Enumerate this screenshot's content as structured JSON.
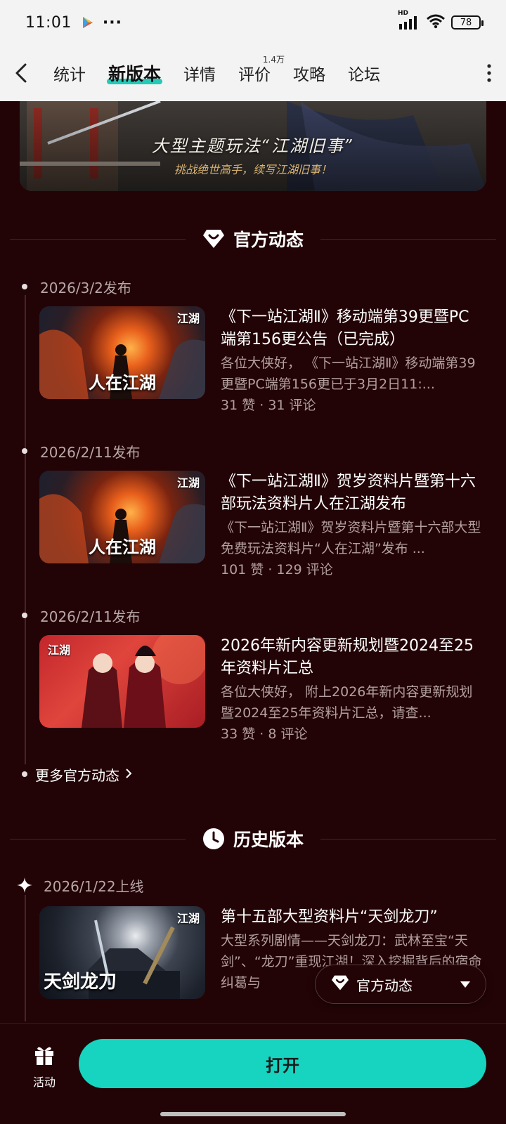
{
  "status_bar": {
    "time": "11:01",
    "dots": "···",
    "hd": "HD",
    "battery": "78"
  },
  "nav": {
    "tabs": [
      {
        "label": "统计"
      },
      {
        "label": "新版本"
      },
      {
        "label": "详情"
      },
      {
        "label": "评价",
        "badge": "1.4万"
      },
      {
        "label": "攻略"
      },
      {
        "label": "论坛"
      }
    ],
    "active_tab": "新版本",
    "accent": "#18c6b4"
  },
  "banner": {
    "title": "大型主题玩法“江湖旧事”",
    "subtitle": "挑战绝世高手，续写江湖旧事！"
  },
  "official": {
    "heading": "官方动态",
    "items": [
      {
        "date": "2026/3/2发布",
        "thumb_text": "人在江湖",
        "thumb_tag": "江湖",
        "title": "《下一站江湖Ⅱ》移动端第39更暨PC端第156更公告（已完成）",
        "desc": "各位大侠好，  《下一站江湖Ⅱ》移动端第39更暨PC端第156更已于3月2日11:...",
        "stats": "31 赞 · 31 评论"
      },
      {
        "date": "2026/2/11发布",
        "thumb_text": "人在江湖",
        "thumb_tag": "江湖",
        "title": "《下一站江湖Ⅱ》贺岁资料片暨第十六部玩法资料片人在江湖发布",
        "desc": "《下一站江湖Ⅱ》贺岁资料片暨第十六部大型免费玩法资料片“人在江湖”发布 ...",
        "stats": "101 赞 · 129 评论"
      },
      {
        "date": "2026/2/11发布",
        "thumb_text": "",
        "thumb_tag": "江湖",
        "title": "2026年新内容更新规划暨2024至25年资料片汇总",
        "desc": "各位大侠好，  附上2026年新内容更新规划暨2024至25年资料片汇总，请查...",
        "stats": "33 赞 · 8 评论"
      }
    ],
    "more_label": "更多官方动态"
  },
  "history": {
    "heading": "历史版本",
    "items": [
      {
        "date": "2026/1/22上线",
        "thumb_text": "天剑龙刀",
        "thumb_tag": "江湖",
        "title": "第十五部大型资料片“天剑龙刀”",
        "desc": "大型系列剧情——天剑龙刀：武林至宝“天剑”、“龙刀”重现江湖！深入挖掘背后的宿命纠葛与"
      }
    ]
  },
  "floating_menu": {
    "label": "官方动态"
  },
  "bottom": {
    "activity_label": "活动",
    "open_label": "打开",
    "button_color": "#16d4c0"
  }
}
